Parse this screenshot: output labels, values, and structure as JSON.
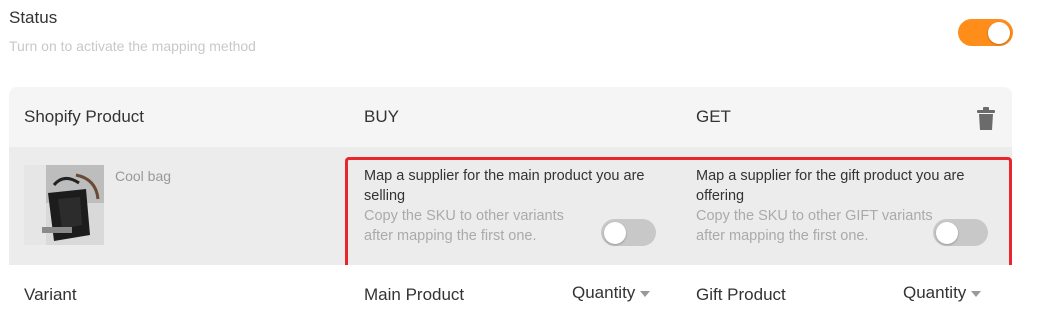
{
  "status": {
    "title": "Status",
    "subtitle": "Turn on to activate the mapping method",
    "toggle_on": true
  },
  "table": {
    "header": {
      "col1": "Shopify Product",
      "col2": "BUY",
      "col3": "GET",
      "delete_icon": "trash-icon"
    },
    "product": {
      "name": "Cool bag",
      "buy": {
        "title": "Map a supplier for the main product you are selling",
        "copy_text": "Copy the SKU to other variants after mapping the first one.",
        "toggle_on": false
      },
      "get": {
        "title": "Map a supplier for the gift product you are offering",
        "copy_text": "Copy the SKU to other GIFT variants after mapping the first one.",
        "toggle_on": false
      }
    },
    "variant_header": {
      "variant": "Variant",
      "main_product": "Main Product",
      "main_quantity": "Quantity",
      "gift_product": "Gift Product",
      "gift_quantity": "Quantity"
    }
  },
  "colors": {
    "accent": "#ff8d1a",
    "highlight": "#e8262b",
    "toggle_off": "#c8c8c8"
  }
}
